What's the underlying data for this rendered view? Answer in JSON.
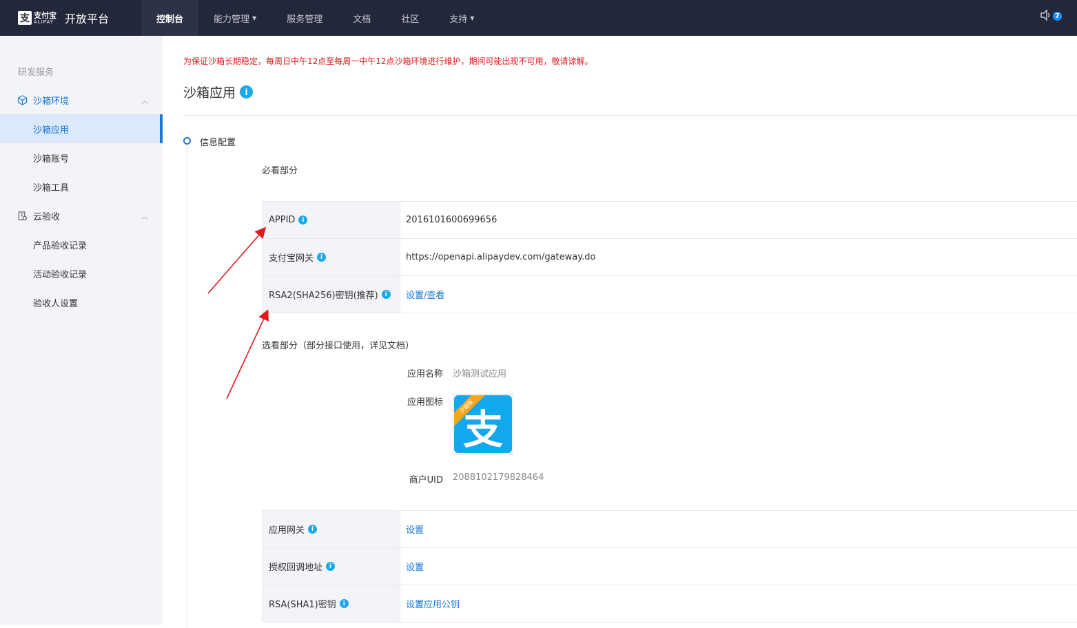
{
  "topbar": {
    "logo_mark": "支",
    "logo_cn": "支付宝",
    "logo_en": "ALIPAY",
    "logo_title": "开放平台",
    "nav": [
      {
        "label": "控制台",
        "active": true
      },
      {
        "label": "能力管理",
        "dropdown": true
      },
      {
        "label": "服务管理"
      },
      {
        "label": "文档"
      },
      {
        "label": "社区"
      },
      {
        "label": "支持",
        "dropdown": true
      }
    ],
    "notifications_count": "7"
  },
  "sidebar": {
    "section_label": "研发服务",
    "groups": [
      {
        "label": "沙箱环境",
        "icon": "cube-icon",
        "open": true,
        "items": [
          "沙箱应用",
          "沙箱账号",
          "沙箱工具"
        ]
      },
      {
        "label": "云验收",
        "icon": "clipboard-icon",
        "open": true,
        "items": [
          "产品验收记录",
          "活动验收记录",
          "验收人设置"
        ]
      }
    ],
    "active_item": "沙箱应用"
  },
  "main": {
    "notice": "为保证沙箱长期稳定，每周日中午12点至每周一中午12点沙箱环境进行维护，期间可能出现不可用，敬请谅解。",
    "page_title": "沙箱应用",
    "page_title_badge": "i",
    "step_title": "信息配置",
    "required_title": "必看部分",
    "required_rows": [
      {
        "key": "APPID",
        "value": "2016101600699656",
        "link": false
      },
      {
        "key": "支付宝网关",
        "value": "https://openapi.alipaydev.com/gateway.do",
        "link": false
      },
      {
        "key": "RSA2(SHA256)密钥(推荐)",
        "value": "设置/查看",
        "link": true
      }
    ],
    "optional_title": "选看部分（部分接口使用，详见文档）",
    "app_name_label": "应用名称",
    "app_name_value": "沙箱测试应用",
    "app_icon_label": "应用图标",
    "app_icon_glyph": "支",
    "app_icon_ribbon": "沙箱版",
    "merchant_uid_label": "商户UID",
    "merchant_uid_value": "2088102179828464",
    "optional_rows": [
      {
        "key": "应用网关",
        "value": "设置",
        "link": true
      },
      {
        "key": "授权回调地址",
        "value": "设置",
        "link": true
      },
      {
        "key": "RSA(SHA1)密钥",
        "value": "设置应用公钥",
        "link": true
      }
    ]
  },
  "colors": {
    "topbar_bg": "#23273a",
    "accent": "#1a77d4",
    "notice_red": "#e0191b",
    "info_badge": "#1ba9e9",
    "annotation_arrow": "#e0191b"
  }
}
